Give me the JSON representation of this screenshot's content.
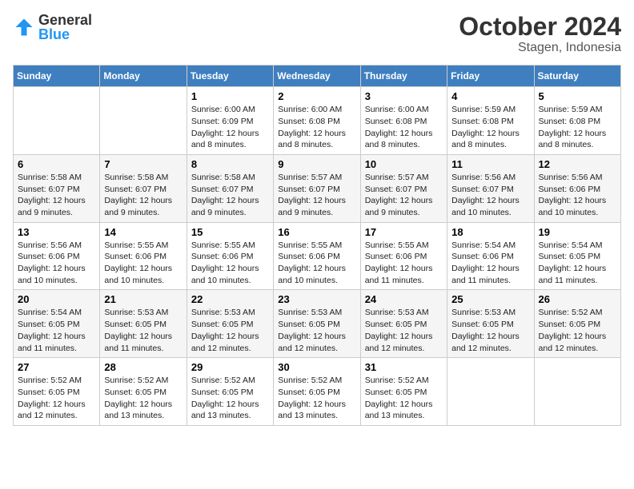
{
  "header": {
    "logo": {
      "general": "General",
      "blue": "Blue"
    },
    "month": "October 2024",
    "location": "Stagen, Indonesia"
  },
  "weekdays": [
    "Sunday",
    "Monday",
    "Tuesday",
    "Wednesday",
    "Thursday",
    "Friday",
    "Saturday"
  ],
  "weeks": [
    [
      null,
      null,
      {
        "day": 1,
        "sunrise": "6:00 AM",
        "sunset": "6:09 PM",
        "daylight": "12 hours and 8 minutes."
      },
      {
        "day": 2,
        "sunrise": "6:00 AM",
        "sunset": "6:08 PM",
        "daylight": "12 hours and 8 minutes."
      },
      {
        "day": 3,
        "sunrise": "6:00 AM",
        "sunset": "6:08 PM",
        "daylight": "12 hours and 8 minutes."
      },
      {
        "day": 4,
        "sunrise": "5:59 AM",
        "sunset": "6:08 PM",
        "daylight": "12 hours and 8 minutes."
      },
      {
        "day": 5,
        "sunrise": "5:59 AM",
        "sunset": "6:08 PM",
        "daylight": "12 hours and 8 minutes."
      }
    ],
    [
      {
        "day": 6,
        "sunrise": "5:58 AM",
        "sunset": "6:07 PM",
        "daylight": "12 hours and 9 minutes."
      },
      {
        "day": 7,
        "sunrise": "5:58 AM",
        "sunset": "6:07 PM",
        "daylight": "12 hours and 9 minutes."
      },
      {
        "day": 8,
        "sunrise": "5:58 AM",
        "sunset": "6:07 PM",
        "daylight": "12 hours and 9 minutes."
      },
      {
        "day": 9,
        "sunrise": "5:57 AM",
        "sunset": "6:07 PM",
        "daylight": "12 hours and 9 minutes."
      },
      {
        "day": 10,
        "sunrise": "5:57 AM",
        "sunset": "6:07 PM",
        "daylight": "12 hours and 9 minutes."
      },
      {
        "day": 11,
        "sunrise": "5:56 AM",
        "sunset": "6:07 PM",
        "daylight": "12 hours and 10 minutes."
      },
      {
        "day": 12,
        "sunrise": "5:56 AM",
        "sunset": "6:06 PM",
        "daylight": "12 hours and 10 minutes."
      }
    ],
    [
      {
        "day": 13,
        "sunrise": "5:56 AM",
        "sunset": "6:06 PM",
        "daylight": "12 hours and 10 minutes."
      },
      {
        "day": 14,
        "sunrise": "5:55 AM",
        "sunset": "6:06 PM",
        "daylight": "12 hours and 10 minutes."
      },
      {
        "day": 15,
        "sunrise": "5:55 AM",
        "sunset": "6:06 PM",
        "daylight": "12 hours and 10 minutes."
      },
      {
        "day": 16,
        "sunrise": "5:55 AM",
        "sunset": "6:06 PM",
        "daylight": "12 hours and 10 minutes."
      },
      {
        "day": 17,
        "sunrise": "5:55 AM",
        "sunset": "6:06 PM",
        "daylight": "12 hours and 11 minutes."
      },
      {
        "day": 18,
        "sunrise": "5:54 AM",
        "sunset": "6:06 PM",
        "daylight": "12 hours and 11 minutes."
      },
      {
        "day": 19,
        "sunrise": "5:54 AM",
        "sunset": "6:05 PM",
        "daylight": "12 hours and 11 minutes."
      }
    ],
    [
      {
        "day": 20,
        "sunrise": "5:54 AM",
        "sunset": "6:05 PM",
        "daylight": "12 hours and 11 minutes."
      },
      {
        "day": 21,
        "sunrise": "5:53 AM",
        "sunset": "6:05 PM",
        "daylight": "12 hours and 11 minutes."
      },
      {
        "day": 22,
        "sunrise": "5:53 AM",
        "sunset": "6:05 PM",
        "daylight": "12 hours and 12 minutes."
      },
      {
        "day": 23,
        "sunrise": "5:53 AM",
        "sunset": "6:05 PM",
        "daylight": "12 hours and 12 minutes."
      },
      {
        "day": 24,
        "sunrise": "5:53 AM",
        "sunset": "6:05 PM",
        "daylight": "12 hours and 12 minutes."
      },
      {
        "day": 25,
        "sunrise": "5:53 AM",
        "sunset": "6:05 PM",
        "daylight": "12 hours and 12 minutes."
      },
      {
        "day": 26,
        "sunrise": "5:52 AM",
        "sunset": "6:05 PM",
        "daylight": "12 hours and 12 minutes."
      }
    ],
    [
      {
        "day": 27,
        "sunrise": "5:52 AM",
        "sunset": "6:05 PM",
        "daylight": "12 hours and 12 minutes."
      },
      {
        "day": 28,
        "sunrise": "5:52 AM",
        "sunset": "6:05 PM",
        "daylight": "12 hours and 13 minutes."
      },
      {
        "day": 29,
        "sunrise": "5:52 AM",
        "sunset": "6:05 PM",
        "daylight": "12 hours and 13 minutes."
      },
      {
        "day": 30,
        "sunrise": "5:52 AM",
        "sunset": "6:05 PM",
        "daylight": "12 hours and 13 minutes."
      },
      {
        "day": 31,
        "sunrise": "5:52 AM",
        "sunset": "6:05 PM",
        "daylight": "12 hours and 13 minutes."
      },
      null,
      null
    ]
  ]
}
